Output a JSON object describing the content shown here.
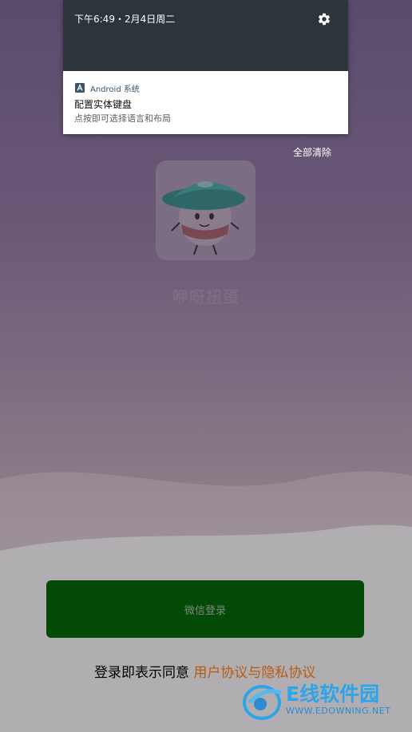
{
  "notification_shade": {
    "time_date": "下午6:49・2月4日周二",
    "settings_icon": "gear-icon",
    "notification": {
      "app_name": "Android 系统",
      "app_icon": "android-system-icon",
      "title": "配置实体键盘",
      "text": "点按即可选择语言和布局"
    },
    "clear_all_label": "全部清除"
  },
  "app": {
    "name": "咿呀扭蛋",
    "logo_icon": "egg-mascot-logo"
  },
  "login": {
    "wechat_label": "微信登录",
    "agreement_prefix": "登录即表示同意 ",
    "agreement_link": "用户协议与隐私协议"
  },
  "watermark": {
    "brand": "E线软件园",
    "url": "WWW.EDOWNING.NET"
  },
  "colors": {
    "login_button": "#024a05",
    "agreement_link": "#b85c15",
    "shade_header": "#2c343c"
  }
}
